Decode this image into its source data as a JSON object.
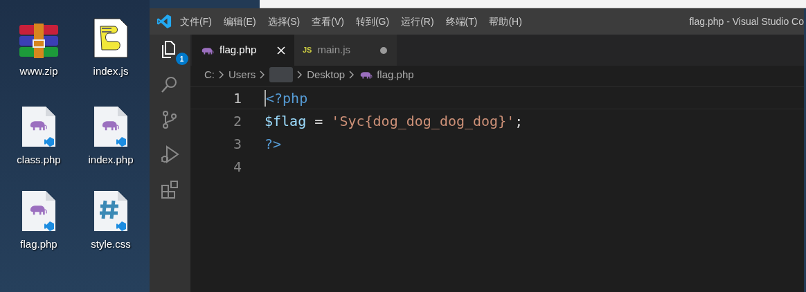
{
  "desktop": {
    "icons": [
      {
        "label": "www.zip",
        "kind": "archive"
      },
      {
        "label": "index.js",
        "kind": "script"
      },
      {
        "label": "class.php",
        "kind": "php"
      },
      {
        "label": "index.php",
        "kind": "php"
      },
      {
        "label": "flag.php",
        "kind": "php"
      },
      {
        "label": "style.css",
        "kind": "css"
      }
    ]
  },
  "window": {
    "title": "flag.php - Visual Studio Co",
    "menu": [
      "文件(F)",
      "编辑(E)",
      "选择(S)",
      "查看(V)",
      "转到(G)",
      "运行(R)",
      "终端(T)",
      "帮助(H)"
    ]
  },
  "activity_bar": [
    {
      "kind": "explorer",
      "selected": true,
      "badge": "1"
    },
    {
      "kind": "search",
      "selected": false
    },
    {
      "kind": "source_control",
      "selected": false
    },
    {
      "kind": "run",
      "selected": false
    },
    {
      "kind": "extensions",
      "selected": false
    }
  ],
  "tabs": [
    {
      "label": "flag.php",
      "kind": "php",
      "selected": true,
      "dirty": false
    },
    {
      "label": "main.js",
      "kind": "js",
      "icon_text": "JS",
      "selected": false,
      "dirty": true
    }
  ],
  "breadcrumb": [
    {
      "kind": "text",
      "label": "C:"
    },
    {
      "kind": "text",
      "label": "Users"
    },
    {
      "kind": "redacted"
    },
    {
      "kind": "text",
      "label": "Desktop"
    },
    {
      "kind": "php",
      "label": "flag.php"
    }
  ],
  "editor": {
    "lines": [
      {
        "number": "1",
        "current": true,
        "tokens": [
          {
            "text": "<?php",
            "color": "#569cd6"
          }
        ]
      },
      {
        "number": "2",
        "current": false,
        "tokens": [
          {
            "text": "$flag",
            "color": "#9cdcfe"
          },
          {
            "text": " = ",
            "color": "#d4d4d4"
          },
          {
            "text": "'Syc{dog_dog_dog_dog}'",
            "color": "#ce9178"
          },
          {
            "text": ";",
            "color": "#d4d4d4"
          }
        ]
      },
      {
        "number": "3",
        "current": false,
        "tokens": [
          {
            "text": "?>",
            "color": "#569cd6"
          }
        ]
      },
      {
        "number": "4",
        "current": false
      }
    ]
  }
}
